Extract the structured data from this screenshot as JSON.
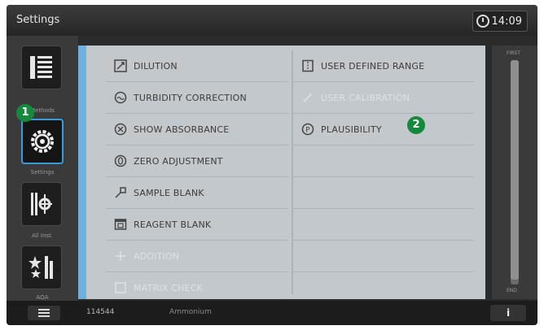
{
  "header": {
    "title": "Settings",
    "time": "14:09"
  },
  "sidebar": {
    "items": [
      {
        "label": "Methods",
        "icon": "list-icon"
      },
      {
        "label": "Settings",
        "icon": "gear-icon"
      },
      {
        "label": "All Inst.",
        "icon": "instrument-icon"
      },
      {
        "label": "AQA",
        "icon": "aqa-icon"
      }
    ]
  },
  "badges": {
    "one": "1",
    "two": "2"
  },
  "options": {
    "left": [
      {
        "label": "DILUTION",
        "icon": "dilution-icon"
      },
      {
        "label": "TURBIDITY CORRECTION",
        "icon": "turbidity-icon"
      },
      {
        "label": "SHOW ABSORBANCE",
        "icon": "absorbance-icon"
      },
      {
        "label": "ZERO ADJUSTMENT",
        "icon": "zero-adjustment-icon"
      },
      {
        "label": "SAMPLE BLANK",
        "icon": "sample-blank-icon"
      },
      {
        "label": "REAGENT BLANK",
        "icon": "reagent-blank-icon"
      },
      {
        "label": "ADDITION",
        "icon": "addition-icon"
      },
      {
        "label": "MATRIX CHECK",
        "icon": "matrix-check-icon"
      }
    ],
    "right": [
      {
        "label": "USER DEFINED RANGE",
        "icon": "user-range-icon"
      },
      {
        "label": "USER CALIBRATION",
        "icon": "calibration-icon"
      },
      {
        "label": "PLAUSIBILITY",
        "icon": "plausibility-icon"
      },
      {
        "label": "",
        "icon": ""
      },
      {
        "label": "",
        "icon": ""
      },
      {
        "label": "",
        "icon": ""
      },
      {
        "label": "",
        "icon": ""
      },
      {
        "label": "",
        "icon": ""
      }
    ]
  },
  "scroll": {
    "top_label": "FIRST",
    "bottom_label": "END"
  },
  "footer": {
    "serial": "114544",
    "status": "Ammonium",
    "info_label": "i"
  },
  "colors": {
    "accent": "#6fb0e0",
    "badge": "#168a3c",
    "panel": "#c3c8cc"
  }
}
